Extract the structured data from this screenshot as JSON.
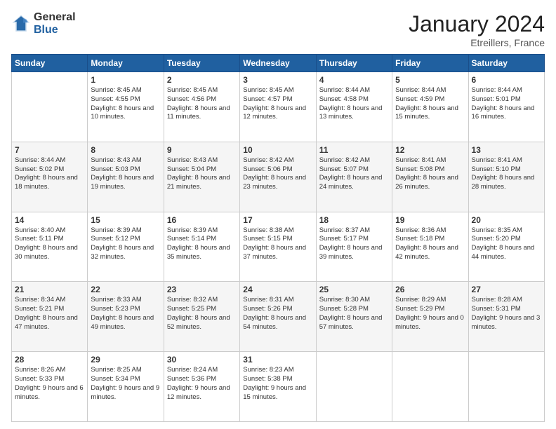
{
  "header": {
    "logo_general": "General",
    "logo_blue": "Blue",
    "title": "January 2024",
    "location": "Etreillers, France"
  },
  "days_of_week": [
    "Sunday",
    "Monday",
    "Tuesday",
    "Wednesday",
    "Thursday",
    "Friday",
    "Saturday"
  ],
  "weeks": [
    [
      {
        "day": "",
        "sunrise": "",
        "sunset": "",
        "daylight": ""
      },
      {
        "day": "1",
        "sunrise": "Sunrise: 8:45 AM",
        "sunset": "Sunset: 4:55 PM",
        "daylight": "Daylight: 8 hours and 10 minutes."
      },
      {
        "day": "2",
        "sunrise": "Sunrise: 8:45 AM",
        "sunset": "Sunset: 4:56 PM",
        "daylight": "Daylight: 8 hours and 11 minutes."
      },
      {
        "day": "3",
        "sunrise": "Sunrise: 8:45 AM",
        "sunset": "Sunset: 4:57 PM",
        "daylight": "Daylight: 8 hours and 12 minutes."
      },
      {
        "day": "4",
        "sunrise": "Sunrise: 8:44 AM",
        "sunset": "Sunset: 4:58 PM",
        "daylight": "Daylight: 8 hours and 13 minutes."
      },
      {
        "day": "5",
        "sunrise": "Sunrise: 8:44 AM",
        "sunset": "Sunset: 4:59 PM",
        "daylight": "Daylight: 8 hours and 15 minutes."
      },
      {
        "day": "6",
        "sunrise": "Sunrise: 8:44 AM",
        "sunset": "Sunset: 5:01 PM",
        "daylight": "Daylight: 8 hours and 16 minutes."
      }
    ],
    [
      {
        "day": "7",
        "sunrise": "Sunrise: 8:44 AM",
        "sunset": "Sunset: 5:02 PM",
        "daylight": "Daylight: 8 hours and 18 minutes."
      },
      {
        "day": "8",
        "sunrise": "Sunrise: 8:43 AM",
        "sunset": "Sunset: 5:03 PM",
        "daylight": "Daylight: 8 hours and 19 minutes."
      },
      {
        "day": "9",
        "sunrise": "Sunrise: 8:43 AM",
        "sunset": "Sunset: 5:04 PM",
        "daylight": "Daylight: 8 hours and 21 minutes."
      },
      {
        "day": "10",
        "sunrise": "Sunrise: 8:42 AM",
        "sunset": "Sunset: 5:06 PM",
        "daylight": "Daylight: 8 hours and 23 minutes."
      },
      {
        "day": "11",
        "sunrise": "Sunrise: 8:42 AM",
        "sunset": "Sunset: 5:07 PM",
        "daylight": "Daylight: 8 hours and 24 minutes."
      },
      {
        "day": "12",
        "sunrise": "Sunrise: 8:41 AM",
        "sunset": "Sunset: 5:08 PM",
        "daylight": "Daylight: 8 hours and 26 minutes."
      },
      {
        "day": "13",
        "sunrise": "Sunrise: 8:41 AM",
        "sunset": "Sunset: 5:10 PM",
        "daylight": "Daylight: 8 hours and 28 minutes."
      }
    ],
    [
      {
        "day": "14",
        "sunrise": "Sunrise: 8:40 AM",
        "sunset": "Sunset: 5:11 PM",
        "daylight": "Daylight: 8 hours and 30 minutes."
      },
      {
        "day": "15",
        "sunrise": "Sunrise: 8:39 AM",
        "sunset": "Sunset: 5:12 PM",
        "daylight": "Daylight: 8 hours and 32 minutes."
      },
      {
        "day": "16",
        "sunrise": "Sunrise: 8:39 AM",
        "sunset": "Sunset: 5:14 PM",
        "daylight": "Daylight: 8 hours and 35 minutes."
      },
      {
        "day": "17",
        "sunrise": "Sunrise: 8:38 AM",
        "sunset": "Sunset: 5:15 PM",
        "daylight": "Daylight: 8 hours and 37 minutes."
      },
      {
        "day": "18",
        "sunrise": "Sunrise: 8:37 AM",
        "sunset": "Sunset: 5:17 PM",
        "daylight": "Daylight: 8 hours and 39 minutes."
      },
      {
        "day": "19",
        "sunrise": "Sunrise: 8:36 AM",
        "sunset": "Sunset: 5:18 PM",
        "daylight": "Daylight: 8 hours and 42 minutes."
      },
      {
        "day": "20",
        "sunrise": "Sunrise: 8:35 AM",
        "sunset": "Sunset: 5:20 PM",
        "daylight": "Daylight: 8 hours and 44 minutes."
      }
    ],
    [
      {
        "day": "21",
        "sunrise": "Sunrise: 8:34 AM",
        "sunset": "Sunset: 5:21 PM",
        "daylight": "Daylight: 8 hours and 47 minutes."
      },
      {
        "day": "22",
        "sunrise": "Sunrise: 8:33 AM",
        "sunset": "Sunset: 5:23 PM",
        "daylight": "Daylight: 8 hours and 49 minutes."
      },
      {
        "day": "23",
        "sunrise": "Sunrise: 8:32 AM",
        "sunset": "Sunset: 5:25 PM",
        "daylight": "Daylight: 8 hours and 52 minutes."
      },
      {
        "day": "24",
        "sunrise": "Sunrise: 8:31 AM",
        "sunset": "Sunset: 5:26 PM",
        "daylight": "Daylight: 8 hours and 54 minutes."
      },
      {
        "day": "25",
        "sunrise": "Sunrise: 8:30 AM",
        "sunset": "Sunset: 5:28 PM",
        "daylight": "Daylight: 8 hours and 57 minutes."
      },
      {
        "day": "26",
        "sunrise": "Sunrise: 8:29 AM",
        "sunset": "Sunset: 5:29 PM",
        "daylight": "Daylight: 9 hours and 0 minutes."
      },
      {
        "day": "27",
        "sunrise": "Sunrise: 8:28 AM",
        "sunset": "Sunset: 5:31 PM",
        "daylight": "Daylight: 9 hours and 3 minutes."
      }
    ],
    [
      {
        "day": "28",
        "sunrise": "Sunrise: 8:26 AM",
        "sunset": "Sunset: 5:33 PM",
        "daylight": "Daylight: 9 hours and 6 minutes."
      },
      {
        "day": "29",
        "sunrise": "Sunrise: 8:25 AM",
        "sunset": "Sunset: 5:34 PM",
        "daylight": "Daylight: 9 hours and 9 minutes."
      },
      {
        "day": "30",
        "sunrise": "Sunrise: 8:24 AM",
        "sunset": "Sunset: 5:36 PM",
        "daylight": "Daylight: 9 hours and 12 minutes."
      },
      {
        "day": "31",
        "sunrise": "Sunrise: 8:23 AM",
        "sunset": "Sunset: 5:38 PM",
        "daylight": "Daylight: 9 hours and 15 minutes."
      },
      {
        "day": "",
        "sunrise": "",
        "sunset": "",
        "daylight": ""
      },
      {
        "day": "",
        "sunrise": "",
        "sunset": "",
        "daylight": ""
      },
      {
        "day": "",
        "sunrise": "",
        "sunset": "",
        "daylight": ""
      }
    ]
  ]
}
